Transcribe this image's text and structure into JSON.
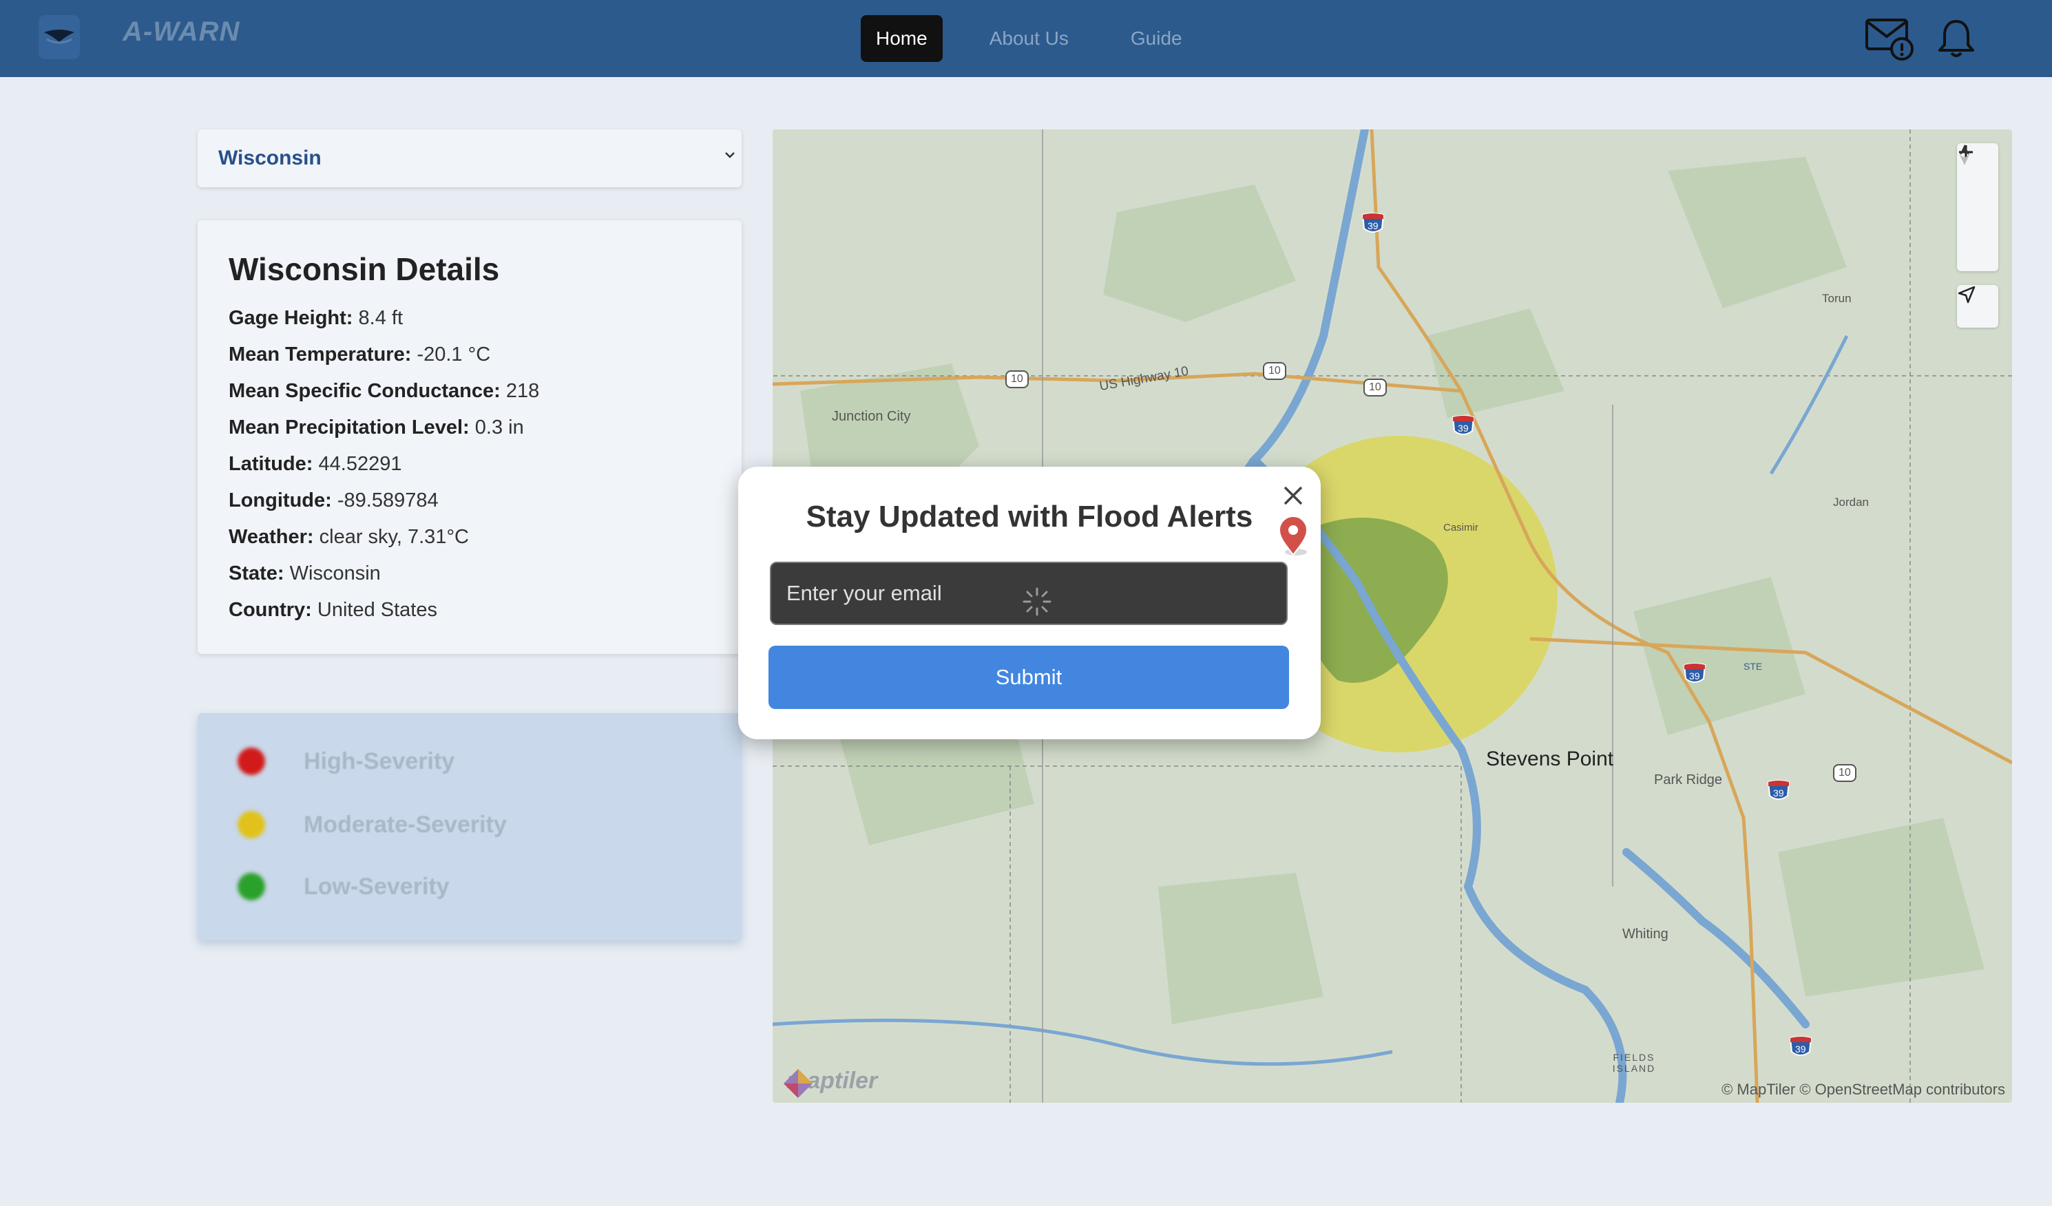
{
  "header": {
    "brand": "A-WARN",
    "nav": [
      {
        "label": "Home",
        "active": true
      },
      {
        "label": "About Us",
        "active": false
      },
      {
        "label": "Guide",
        "active": false
      }
    ],
    "icons": [
      "mail-alert-icon",
      "bell-icon"
    ]
  },
  "state_select": {
    "value": "Wisconsin"
  },
  "details": {
    "title": "Wisconsin Details",
    "rows": [
      {
        "label": "Gage Height:",
        "value": "8.4 ft"
      },
      {
        "label": "Mean Temperature:",
        "value": "-20.1 °C"
      },
      {
        "label": "Mean Specific Conductance:",
        "value": "218"
      },
      {
        "label": "Mean Precipitation Level:",
        "value": "0.3 in"
      },
      {
        "label": "Latitude:",
        "value": "44.52291"
      },
      {
        "label": "Longitude:",
        "value": "-89.589784"
      },
      {
        "label": "Weather:",
        "value": "clear sky, 7.31°C"
      },
      {
        "label": "State:",
        "value": "Wisconsin"
      },
      {
        "label": "Country:",
        "value": "United States"
      }
    ]
  },
  "legend": [
    {
      "label": "High-Severity",
      "color": "#d11a1a"
    },
    {
      "label": "Moderate-Severity",
      "color": "#e0c21a"
    },
    {
      "label": "Low-Severity",
      "color": "#2aa12a"
    }
  ],
  "map": {
    "places": {
      "junction_city": "Junction City",
      "stevens_point": "Stevens Point",
      "park_ridge": "Park Ridge",
      "whiting": "Whiting",
      "jordan": "Jordan",
      "torun": "Torun",
      "casimir": "Casimir",
      "fields_island": "FIELDS ISLAND",
      "us_highway": "US Highway 10",
      "ste": "STE"
    },
    "shields": {
      "i39": "39",
      "us10": "10"
    },
    "attribution": "© MapTiler © OpenStreetMap contributors",
    "maptiler_logo": "maptiler",
    "zoom_in": "+",
    "zoom_out": "−"
  },
  "modal": {
    "title": "Stay Updated with Flood Alerts",
    "email_placeholder": "Enter your email",
    "submit_label": "Submit"
  }
}
